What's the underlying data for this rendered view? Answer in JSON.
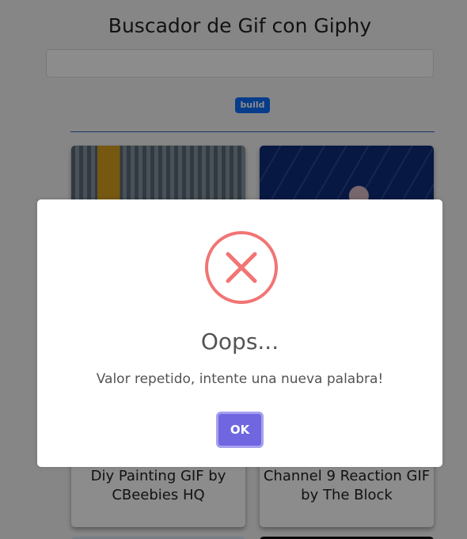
{
  "app": {
    "title": "Buscador de Gif con Giphy",
    "search_value": "",
    "tag": "build"
  },
  "cards": [
    {
      "image": "lego-build-scene",
      "caption": "Diy Painting GIF by CBeebies HQ"
    },
    {
      "image": "blue-rain-scene",
      "caption": "Channel 9 Reaction GIF by The Block"
    }
  ],
  "dialog": {
    "icon": "error-x-icon",
    "title": "Oops...",
    "message": "Valor repetido, intente una nueva palabra!",
    "ok_label": "OK"
  },
  "colors": {
    "accent": "#7066e0",
    "error": "#f27474",
    "badge": "#0d6efd"
  }
}
